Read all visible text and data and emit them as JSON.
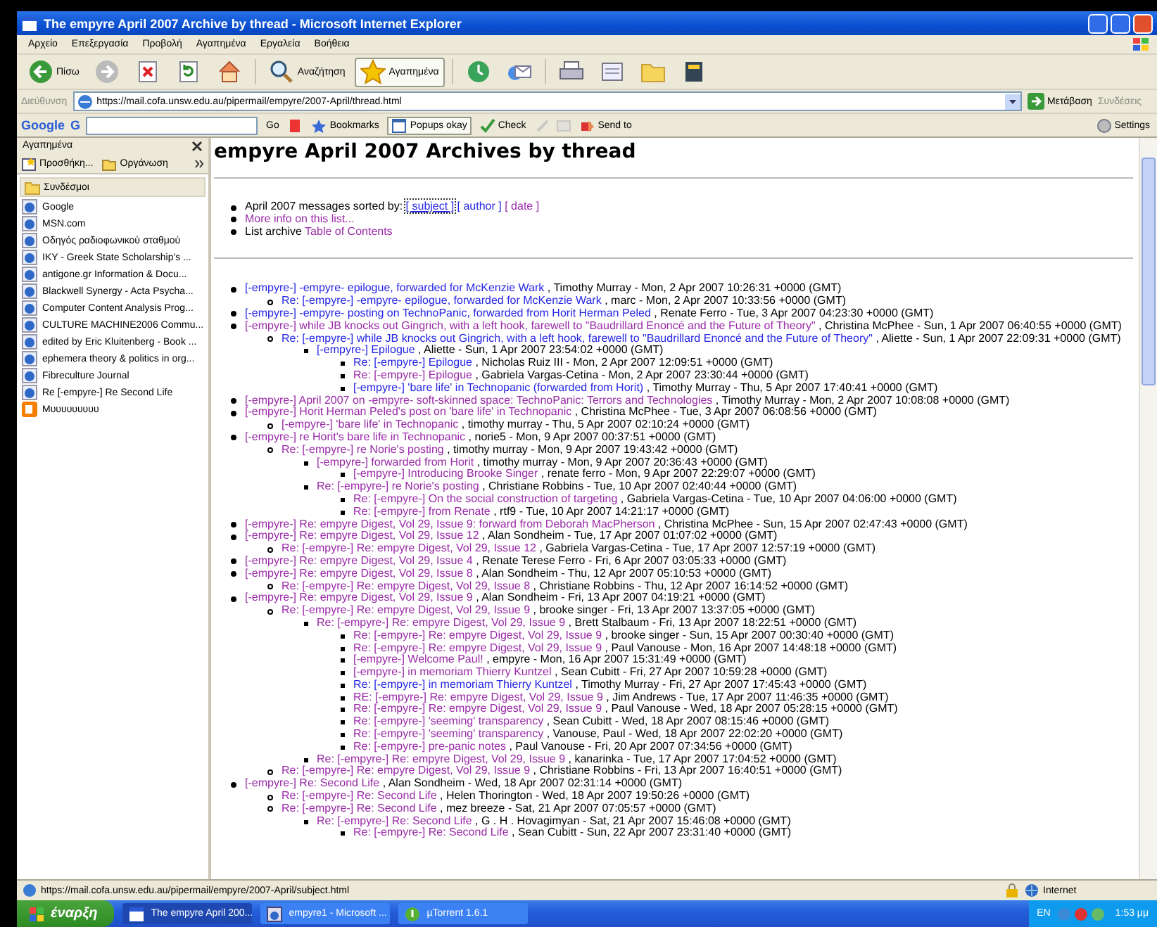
{
  "window": {
    "title": "The empyre April 2007 Archive by thread - Microsoft Internet Explorer"
  },
  "menu_bar": [
    "Αρχείο",
    "Επεξεργασία",
    "Προβολή",
    "Αγαπημένα",
    "Εργαλεία",
    "Βοήθεια"
  ],
  "toolbar": [
    {
      "kind": "back",
      "label": "Πίσω",
      "pressed": false
    },
    {
      "kind": "forward",
      "pressed": false
    },
    {
      "kind": "stop",
      "pressed": false
    },
    {
      "kind": "refresh",
      "pressed": false
    },
    {
      "kind": "home",
      "pressed": false
    },
    {
      "kind": "search",
      "label": "Αναζήτηση",
      "pressed": false
    },
    {
      "kind": "favorites",
      "label": "Αγαπημένα",
      "pressed": true
    },
    {
      "kind": "history",
      "pressed": false
    },
    {
      "kind": "mail",
      "pressed": false
    },
    {
      "kind": "print",
      "pressed": false
    },
    {
      "kind": "edit",
      "pressed": false
    },
    {
      "kind": "folder",
      "pressed": false
    },
    {
      "kind": "research",
      "pressed": false
    }
  ],
  "address_bar": {
    "label": "Διεύθυνση",
    "url": "https://mail.cofa.unsw.edu.au/pipermail/empyre/2007-April/thread.html",
    "go": "Μετάβαση",
    "links": "Συνδέσεις"
  },
  "google_toolbar": {
    "logo": "Google",
    "g_menu": "G",
    "go": "Go",
    "bookmarks": "Bookmarks",
    "popups": "Popups okay",
    "check": "Check",
    "send_to": "Send to",
    "settings": "Settings"
  },
  "sidebar": {
    "title": "Αγαπημένα",
    "add": "Προσθήκη...",
    "organize": "Οργάνωση",
    "folder": "Συνδέσμοι",
    "items": [
      {
        "kind": "page",
        "label": "Google"
      },
      {
        "kind": "page",
        "label": "MSN.com"
      },
      {
        "kind": "page",
        "label": "Οδηγός ραδιοφωνικού σταθμού"
      },
      {
        "kind": "page",
        "label": "ΙΚΥ - Greek State Scholarship's ..."
      },
      {
        "kind": "page",
        "label": "antigone.gr Information & Docu..."
      },
      {
        "kind": "page",
        "label": "Blackwell Synergy - Acta Psycha..."
      },
      {
        "kind": "page",
        "label": "Computer Content Analysis Prog..."
      },
      {
        "kind": "page",
        "label": "CULTURE MACHINE2006 Commu..."
      },
      {
        "kind": "page",
        "label": "edited by Eric Kluitenberg - Book ..."
      },
      {
        "kind": "page",
        "label": "ephemera theory & politics in org..."
      },
      {
        "kind": "page",
        "label": "Fibreculture Journal"
      },
      {
        "kind": "page",
        "label": "Re [-empyre-] Re Second Life"
      },
      {
        "kind": "blog",
        "label": "Μυυυυυυυυυ"
      }
    ]
  },
  "page": {
    "heading": "empyre April 2007 Archives by thread",
    "sort_label": "April 2007 messages sorted by:",
    "sort_links": [
      {
        "label": "[ subject ]",
        "visited": false
      },
      {
        "label": "[ author ]",
        "visited": false
      },
      {
        "label": "[ date ]",
        "visited": true
      }
    ],
    "info_link": {
      "label": "More info on this list...",
      "visited": true
    },
    "toc_prefix": "List archive",
    "toc_link": {
      "label": "Table of Contents",
      "visited": true
    },
    "threads": [
      {
        "subject": "[-empyre-] -empyre- epilogue, forwarded for McKenzie Wark",
        "visited": false,
        "byline": ", Timothy Murray - Mon, 2 Apr 2007 10:26:31 +0000 (GMT)",
        "children": [
          {
            "subject": "Re: [-empyre-] -empyre- epilogue, forwarded for McKenzie Wark",
            "visited": false,
            "byline": ", marc - Mon, 2 Apr 2007 10:33:56 +0000 (GMT)"
          }
        ]
      },
      {
        "subject": "[-empyre-] -empyre- posting on TechnoPanic, forwarded from Horit Herman Peled",
        "visited": false,
        "byline": ", Renate Ferro - Tue, 3 Apr 2007 04:23:30 +0000 (GMT)"
      },
      {
        "subject": "[-empyre-] while JB knocks out Gingrich, with a left hook, farewell to \"Baudrillard Enoncé and the Future of Theory\"",
        "visited": true,
        "byline": ", Christina McPhee - Sun, 1 Apr 2007 06:40:55 +0000 (GMT)",
        "children": [
          {
            "subject": "Re: [-empyre-] while JB knocks out Gingrich, with a left hook, farewell to \"Baudrillard Enoncé and the Future of Theory\"",
            "visited": false,
            "byline": ", Aliette - Sun, 1 Apr 2007 22:09:31 +0000 (GMT)",
            "children": [
              {
                "subject": "[-empyre-] Epilogue",
                "visited": false,
                "byline": ", Aliette - Sun, 1 Apr 2007 23:54:02 +0000 (GMT)",
                "children": [
                  {
                    "subject": "Re: [-empyre-] Epilogue",
                    "visited": false,
                    "byline": ", Nicholas Ruiz III - Mon, 2 Apr 2007 12:09:51 +0000 (GMT)"
                  },
                  {
                    "subject": "Re: [-empyre-] Epilogue",
                    "visited": true,
                    "byline": ", Gabriela Vargas-Cetina - Mon, 2 Apr 2007 23:30:44 +0000 (GMT)"
                  },
                  {
                    "subject": "[-empyre-] 'bare life' in Technopanic (forwarded from Horit)",
                    "visited": false,
                    "byline": ", Timothy Murray - Thu, 5 Apr 2007 17:40:41 +0000 (GMT)"
                  }
                ]
              }
            ]
          }
        ]
      },
      {
        "subject": "[-empyre-] April 2007 on -empyre- soft-skinned space: TechnoPanic: Terrors and Technologies",
        "visited": true,
        "byline": ", Timothy Murray - Mon, 2 Apr 2007 10:08:08 +0000 (GMT)"
      },
      {
        "subject": "[-empyre-] Horit Herman Peled's post on 'bare life' in Technopanic",
        "visited": true,
        "byline": ", Christina McPhee - Tue, 3 Apr 2007 06:08:56 +0000 (GMT)",
        "children": [
          {
            "subject": "[-empyre-] 'bare life' in Technopanic",
            "visited": true,
            "byline": ", timothy murray - Thu, 5 Apr 2007 02:10:24 +0000 (GMT)"
          }
        ]
      },
      {
        "subject": "[-empyre-] re Horit's bare life in Technopanic",
        "visited": true,
        "byline": ", norie5 - Mon, 9 Apr 2007 00:37:51 +0000 (GMT)",
        "children": [
          {
            "subject": "Re: [-empyre-] re Norie's posting",
            "visited": true,
            "byline": ", timothy murray - Mon, 9 Apr 2007 19:43:42 +0000 (GMT)",
            "children": [
              {
                "subject": "[-empyre-] forwarded from Horit",
                "visited": true,
                "byline": ", timothy murray - Mon, 9 Apr 2007 20:36:43 +0000 (GMT)",
                "children": [
                  {
                    "subject": "[-empyre-] Introducing Brooke Singer",
                    "visited": true,
                    "byline": ", renate ferro - Mon, 9 Apr 2007 22:29:07 +0000 (GMT)"
                  }
                ]
              },
              {
                "subject": "Re: [-empyre-] re Norie's posting",
                "visited": true,
                "byline": ", Christiane Robbins - Tue, 10 Apr 2007 02:40:44 +0000 (GMT)",
                "children": [
                  {
                    "subject": "Re: [-empyre-] On the social construction of targeting",
                    "visited": true,
                    "byline": ", Gabriela Vargas-Cetina - Tue, 10 Apr 2007 04:06:00 +0000 (GMT)"
                  },
                  {
                    "subject": "Re: [-empyre-] from Renate",
                    "visited": true,
                    "byline": ", rtf9 - Tue, 10 Apr 2007 14:21:17 +0000 (GMT)"
                  }
                ]
              }
            ]
          }
        ]
      },
      {
        "subject": "[-empyre-] Re: empyre Digest, Vol 29, Issue 9: forward from Deborah MacPherson",
        "visited": true,
        "byline": ", Christina McPhee - Sun, 15 Apr 2007 02:47:43 +0000 (GMT)"
      },
      {
        "subject": "[-empyre-] Re: empyre Digest, Vol 29, Issue 12",
        "visited": true,
        "byline": ", Alan Sondheim - Tue, 17 Apr 2007 01:07:02 +0000 (GMT)",
        "children": [
          {
            "subject": "Re: [-empyre-] Re: empyre Digest, Vol 29, Issue 12",
            "visited": true,
            "byline": ", Gabriela Vargas-Cetina - Tue, 17 Apr 2007 12:57:19 +0000 (GMT)"
          }
        ]
      },
      {
        "subject": "[-empyre-] Re: empyre Digest, Vol 29, Issue 4",
        "visited": true,
        "byline": ", Renate Terese Ferro - Fri, 6 Apr 2007 03:05:33 +0000 (GMT)"
      },
      {
        "subject": "[-empyre-] Re: empyre Digest, Vol 29, Issue 8",
        "visited": true,
        "byline": ", Alan Sondheim - Thu, 12 Apr 2007 05:10:53 +0000 (GMT)",
        "children": [
          {
            "subject": "Re: [-empyre-] Re: empyre Digest, Vol 29, Issue 8",
            "visited": true,
            "byline": ", Christiane Robbins - Thu, 12 Apr 2007 16:14:52 +0000 (GMT)"
          }
        ]
      },
      {
        "subject": "[-empyre-] Re: empyre Digest, Vol 29, Issue 9",
        "visited": true,
        "byline": ", Alan Sondheim - Fri, 13 Apr 2007 04:19:21 +0000 (GMT)",
        "children": [
          {
            "subject": "Re: [-empyre-] Re: empyre Digest, Vol 29, Issue 9",
            "visited": true,
            "byline": ", brooke singer - Fri, 13 Apr 2007 13:37:05 +0000 (GMT)",
            "children": [
              {
                "subject": "Re: [-empyre-] Re: empyre Digest, Vol 29, Issue 9",
                "visited": true,
                "byline": ", Brett Stalbaum - Fri, 13 Apr 2007 18:22:51 +0000 (GMT)",
                "children": [
                  {
                    "subject": "Re: [-empyre-] Re: empyre Digest, Vol 29, Issue 9",
                    "visited": true,
                    "byline": ", brooke singer - Sun, 15 Apr 2007 00:30:40 +0000 (GMT)"
                  },
                  {
                    "subject": "Re: [-empyre-] Re: empyre Digest, Vol 29, Issue 9",
                    "visited": true,
                    "byline": ", Paul Vanouse - Mon, 16 Apr 2007 14:48:18 +0000 (GMT)"
                  },
                  {
                    "subject": "[-empyre-] Welcome Paul!",
                    "visited": true,
                    "byline": ", empyre - Mon, 16 Apr 2007 15:31:49 +0000 (GMT)"
                  },
                  {
                    "subject": "[-empyre-] in memoriam Thierry Kuntzel",
                    "visited": true,
                    "byline": ", Sean Cubitt - Fri, 27 Apr 2007 10:59:28 +0000 (GMT)"
                  },
                  {
                    "subject": "Re: [-empyre-] in memoriam Thierry Kuntzel",
                    "visited": false,
                    "byline": ", Timothy Murray - Fri, 27 Apr 2007 17:45:43 +0000 (GMT)"
                  },
                  {
                    "subject": "RE: [-empyre-] Re: empyre Digest, Vol 29, Issue 9",
                    "visited": true,
                    "byline": ", Jim Andrews - Tue, 17 Apr 2007 11:46:35 +0000 (GMT)"
                  },
                  {
                    "subject": "Re: [-empyre-] Re: empyre Digest, Vol 29, Issue 9",
                    "visited": true,
                    "byline": ", Paul Vanouse - Wed, 18 Apr 2007 05:28:15 +0000 (GMT)"
                  },
                  {
                    "subject": "Re: [-empyre-] 'seeming' transparency",
                    "visited": true,
                    "byline": ", Sean Cubitt - Wed, 18 Apr 2007 08:15:46 +0000 (GMT)"
                  },
                  {
                    "subject": "Re: [-empyre-] 'seeming' transparency",
                    "visited": true,
                    "byline": ", Vanouse, Paul - Wed, 18 Apr 2007 22:02:20 +0000 (GMT)"
                  },
                  {
                    "subject": "Re: [-empyre-] pre-panic notes",
                    "visited": true,
                    "byline": ", Paul Vanouse - Fri, 20 Apr 2007 07:34:56 +0000 (GMT)"
                  }
                ]
              },
              {
                "subject": "Re: [-empyre-] Re: empyre Digest, Vol 29, Issue 9",
                "visited": true,
                "byline": ", kanarinka - Tue, 17 Apr 2007 17:04:52 +0000 (GMT)"
              }
            ]
          },
          {
            "subject": "Re: [-empyre-] Re: empyre Digest, Vol 29, Issue 9",
            "visited": true,
            "byline": ", Christiane Robbins - Fri, 13 Apr 2007 16:40:51 +0000 (GMT)"
          }
        ]
      },
      {
        "subject": "[-empyre-] Re: Second Life",
        "visited": true,
        "byline": ", Alan Sondheim - Wed, 18 Apr 2007 02:31:14 +0000 (GMT)",
        "children": [
          {
            "subject": "Re: [-empyre-] Re: Second Life",
            "visited": true,
            "byline": ", Helen Thorington - Wed, 18 Apr 2007 19:50:26 +0000 (GMT)"
          },
          {
            "subject": "Re: [-empyre-] Re: Second Life",
            "visited": true,
            "byline": ", mez breeze - Sat, 21 Apr 2007 07:05:57 +0000 (GMT)",
            "children": [
              {
                "subject": "Re: [-empyre-] Re: Second Life",
                "visited": true,
                "byline": ", G . H . Hovagimyan - Sat, 21 Apr 2007 15:46:08 +0000 (GMT)",
                "children": [
                  {
                    "subject": "Re: [-empyre-] Re: Second Life",
                    "visited": true,
                    "byline": ", Sean Cubitt - Sun, 22 Apr 2007 23:31:40 +0000 (GMT)"
                  }
                ]
              }
            ]
          }
        ]
      }
    ]
  },
  "status_bar": {
    "url": "https://mail.cofa.unsw.edu.au/pipermail/empyre/2007-April/subject.html",
    "zone": "Internet"
  },
  "taskbar": {
    "start": "έναρξη",
    "tasks": [
      {
        "label": "The empyre April 200...",
        "selected": true
      },
      {
        "label": "empyre1 - Microsoft ...",
        "selected": false
      },
      {
        "label": "µTorrent 1.6.1",
        "selected": false
      }
    ],
    "language": "EN",
    "clock": "1:53 μμ"
  }
}
